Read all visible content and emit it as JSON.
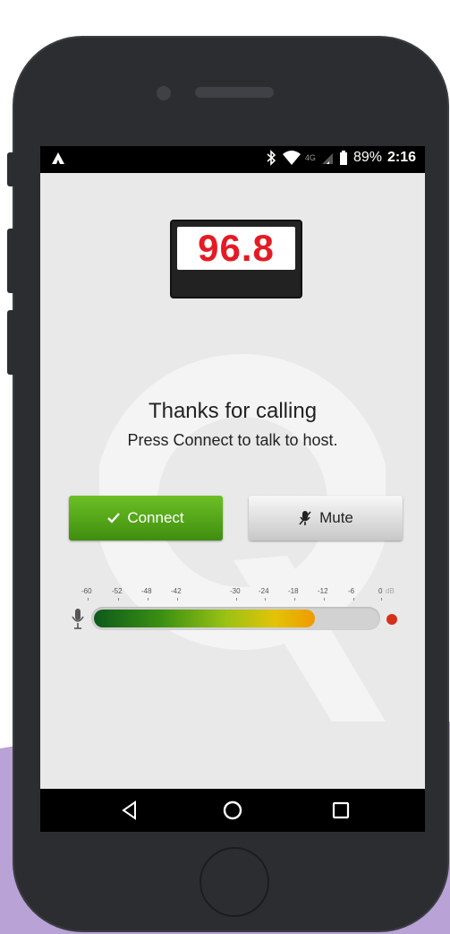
{
  "status_bar": {
    "left_icon": "app-notification-icon",
    "network_label": "4G",
    "battery_percent": "89%",
    "time": "2:16"
  },
  "station": {
    "frequency": "96.8"
  },
  "message": {
    "title": "Thanks for calling",
    "subtitle": "Press Connect to talk to host."
  },
  "actions": {
    "connect_label": "Connect",
    "mute_label": "Mute"
  },
  "meter": {
    "scale_labels": [
      "-60",
      "-52",
      "-48",
      "-42",
      "-30",
      "-24",
      "-18",
      "-12",
      "-6",
      "0"
    ],
    "unit": "dB",
    "level_fraction": 0.78
  },
  "colors": {
    "accent_green": "#4ea517",
    "frequency_red": "#e51b24",
    "phone_body": "#2b2d31",
    "background_purple": "#b9a2d6"
  },
  "nav": {
    "back": "back-icon",
    "home": "home-icon",
    "recents": "recents-icon"
  }
}
